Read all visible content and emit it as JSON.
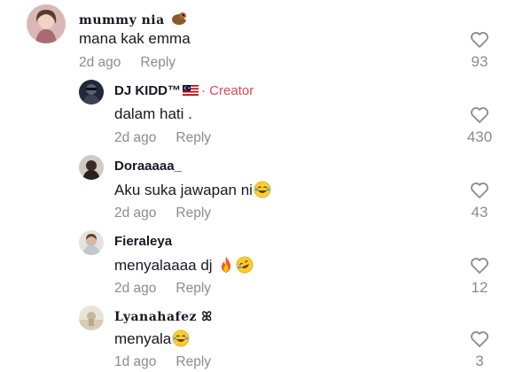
{
  "comments": [
    {
      "username": "mummy nia",
      "text": "mana kak emma",
      "time": "2d ago",
      "reply_label": "Reply",
      "likes": "93",
      "username_emoji": "beaver-emoji"
    },
    {
      "username": "DJ KIDD™",
      "creator_label": "· Creator",
      "text": "dalam hati .",
      "time": "2d ago",
      "reply_label": "Reply",
      "likes": "430",
      "flag": "malaysia-flag"
    },
    {
      "username": "Doraaaaa_",
      "text": "Aku suka jawapan ni",
      "time": "2d ago",
      "reply_label": "Reply",
      "likes": "43",
      "text_emoji": "laughing-tears-emoji"
    },
    {
      "username": "Fieraleya",
      "text": "menyalaaaa dj",
      "time": "2d ago",
      "reply_label": "Reply",
      "likes": "12",
      "text_emoji": "fire-emoji, rofl-emoji"
    },
    {
      "username": "Lyanahafez",
      "username_suffix": "ꕤ",
      "text": "menyala",
      "time": "1d ago",
      "reply_label": "Reply",
      "likes": "3",
      "text_emoji": "laughing-tears-emoji"
    }
  ],
  "colors": {
    "text": "#161823",
    "muted": "#8a8b91",
    "creator": "#e4475d"
  }
}
